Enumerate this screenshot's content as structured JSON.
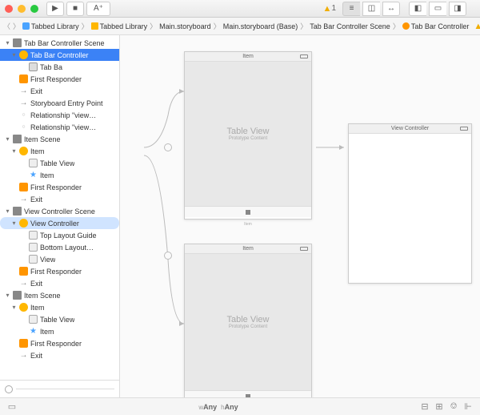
{
  "toolbar": {
    "warning_count": "1",
    "run_icon": "▶",
    "stop_icon": "■",
    "scheme_icon": "A⁺"
  },
  "breadcrumb": [
    {
      "icon": "blue",
      "label": "Tabbed Library"
    },
    {
      "icon": "yellow",
      "label": "Tabbed Library"
    },
    {
      "icon": "none",
      "label": "Main.storyboard"
    },
    {
      "icon": "none",
      "label": "Main.storyboard (Base)"
    },
    {
      "icon": "none",
      "label": "Tab Bar Controller Scene"
    },
    {
      "icon": "orange",
      "label": "Tab Bar Controller"
    }
  ],
  "jump": {
    "warn": "1"
  },
  "outline": [
    {
      "d": 1,
      "ind": 0,
      "ic": "scene",
      "lbl": "Tab Bar Controller Scene",
      "sel": ""
    },
    {
      "d": 1,
      "ind": 1,
      "ic": "yellowcircle",
      "lbl": "Tab Bar Controller",
      "sel": "blue"
    },
    {
      "d": 0,
      "ind": 2,
      "ic": "tab",
      "lbl": "Tab Ba",
      "sel": ""
    },
    {
      "d": 0,
      "ind": 1,
      "ic": "cube",
      "lbl": "First Responder",
      "sel": ""
    },
    {
      "d": 0,
      "ind": 1,
      "ic": "arrow",
      "lbl": "Exit",
      "sel": ""
    },
    {
      "d": 0,
      "ind": 1,
      "ic": "arrow",
      "lbl": "Storyboard Entry Point",
      "sel": ""
    },
    {
      "d": 0,
      "ind": 1,
      "ic": "rel",
      "lbl": "Relationship \"view…",
      "sel": ""
    },
    {
      "d": 0,
      "ind": 1,
      "ic": "rel",
      "lbl": "Relationship \"view…",
      "sel": ""
    },
    {
      "d": 1,
      "ind": 0,
      "ic": "scene",
      "lbl": "Item Scene",
      "sel": ""
    },
    {
      "d": 1,
      "ind": 1,
      "ic": "yellowcircle",
      "lbl": "Item",
      "sel": ""
    },
    {
      "d": 0,
      "ind": 2,
      "ic": "tv",
      "lbl": "Table View",
      "sel": ""
    },
    {
      "d": 0,
      "ind": 2,
      "ic": "star",
      "lbl": "Item",
      "sel": ""
    },
    {
      "d": 0,
      "ind": 1,
      "ic": "cube",
      "lbl": "First Responder",
      "sel": ""
    },
    {
      "d": 0,
      "ind": 1,
      "ic": "arrow",
      "lbl": "Exit",
      "sel": ""
    },
    {
      "d": 1,
      "ind": 0,
      "ic": "scene",
      "lbl": "View Controller Scene",
      "sel": ""
    },
    {
      "d": 1,
      "ind": 1,
      "ic": "yellowcircle",
      "lbl": "View Controller",
      "sel": "light"
    },
    {
      "d": 0,
      "ind": 2,
      "ic": "tv",
      "lbl": "Top Layout Guide",
      "sel": ""
    },
    {
      "d": 0,
      "ind": 2,
      "ic": "tv",
      "lbl": "Bottom Layout…",
      "sel": ""
    },
    {
      "d": 0,
      "ind": 2,
      "ic": "tv",
      "lbl": "View",
      "sel": ""
    },
    {
      "d": 0,
      "ind": 1,
      "ic": "cube",
      "lbl": "First Responder",
      "sel": ""
    },
    {
      "d": 0,
      "ind": 1,
      "ic": "arrow",
      "lbl": "Exit",
      "sel": ""
    },
    {
      "d": 1,
      "ind": 0,
      "ic": "scene",
      "lbl": "Item Scene",
      "sel": ""
    },
    {
      "d": 1,
      "ind": 1,
      "ic": "yellowcircle",
      "lbl": "Item",
      "sel": ""
    },
    {
      "d": 0,
      "ind": 2,
      "ic": "tv",
      "lbl": "Table View",
      "sel": ""
    },
    {
      "d": 0,
      "ind": 2,
      "ic": "star",
      "lbl": "Item",
      "sel": ""
    },
    {
      "d": 0,
      "ind": 1,
      "ic": "cube",
      "lbl": "First Responder",
      "sel": ""
    },
    {
      "d": 0,
      "ind": 1,
      "ic": "arrow",
      "lbl": "Exit",
      "sel": ""
    }
  ],
  "canvas": {
    "tv_label": "Table View",
    "tv_sub": "Prototype Content",
    "vc_label": "View Controller",
    "item_label": "Item"
  },
  "sizeclass": {
    "w": "w",
    "any1": "Any",
    "h": "h",
    "any2": "Any"
  }
}
